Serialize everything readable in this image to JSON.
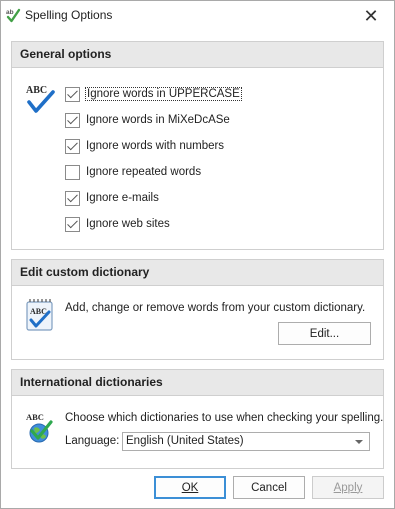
{
  "window": {
    "title": "Spelling Options",
    "icon": "spell-check-icon",
    "close_glyph": "✕"
  },
  "general": {
    "header": "General options",
    "icon_text": "ABC",
    "options": [
      {
        "label": "Ignore words in UPPERCASE",
        "checked": true,
        "focused": true
      },
      {
        "label": "Ignore words in MiXeDcASe",
        "checked": true,
        "focused": false
      },
      {
        "label": "Ignore words with numbers",
        "checked": true,
        "focused": false
      },
      {
        "label": "Ignore repeated words",
        "checked": false,
        "focused": false
      },
      {
        "label": "Ignore e-mails",
        "checked": true,
        "focused": false
      },
      {
        "label": "Ignore web sites",
        "checked": true,
        "focused": false
      }
    ]
  },
  "custom_dict": {
    "header": "Edit custom dictionary",
    "icon_text": "ABC",
    "description": "Add, change or remove words from your custom dictionary.",
    "edit_button": "Edit..."
  },
  "intl_dict": {
    "header": "International dictionaries",
    "icon_text": "ABC",
    "description": "Choose which dictionaries to use when checking your spelling.",
    "language_label": "Language:",
    "language_value": "English (United States)"
  },
  "footer": {
    "ok": "OK",
    "cancel": "Cancel",
    "apply": "Apply"
  },
  "colors": {
    "accent": "#3c8fd6",
    "header_bg": "#e8e8e8",
    "check_blue": "#1f6fc7",
    "check_green": "#43a047"
  }
}
